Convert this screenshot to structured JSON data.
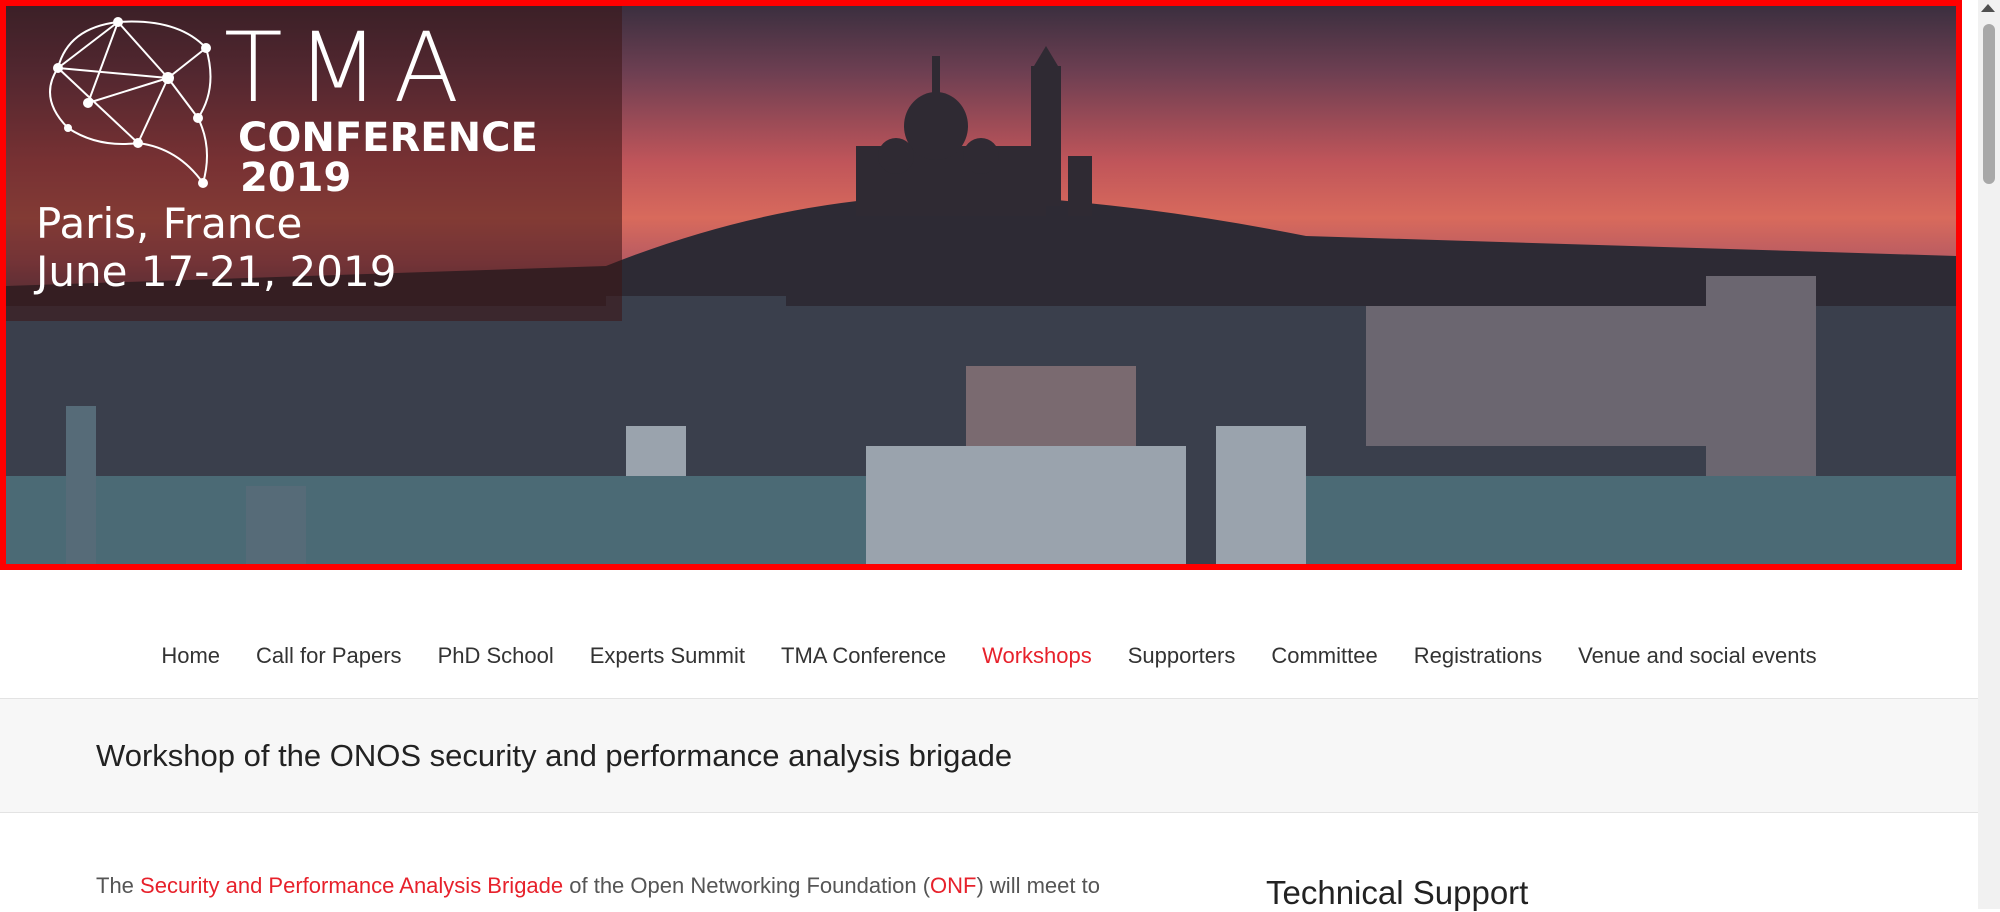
{
  "banner": {
    "logo_word": "TMA",
    "logo_sub": "CONFERENCE",
    "logo_year": "2019",
    "location": "Paris, France",
    "dates": "June 17-21, 2019"
  },
  "nav": {
    "items": [
      {
        "label": "Home"
      },
      {
        "label": "Call for Papers"
      },
      {
        "label": "PhD School"
      },
      {
        "label": "Experts Summit"
      },
      {
        "label": "TMA Conference"
      },
      {
        "label": "Workshops"
      },
      {
        "label": "Supporters"
      },
      {
        "label": "Committee"
      },
      {
        "label": "Registrations"
      },
      {
        "label": "Venue and social events"
      }
    ],
    "active_index": 5
  },
  "page": {
    "title": "Workshop of the ONOS security and performance analysis brigade",
    "intro_prefix": "The ",
    "intro_link1": "Security and Performance Analysis Brigade",
    "intro_middle": " of the Open Networking Foundation (",
    "intro_link2": "ONF",
    "intro_suffix": ") will meet to"
  },
  "sidebar": {
    "heading": "Technical Support"
  },
  "colors": {
    "accent": "#e7212b",
    "banner_border": "#ff0000",
    "text": "#333333"
  }
}
